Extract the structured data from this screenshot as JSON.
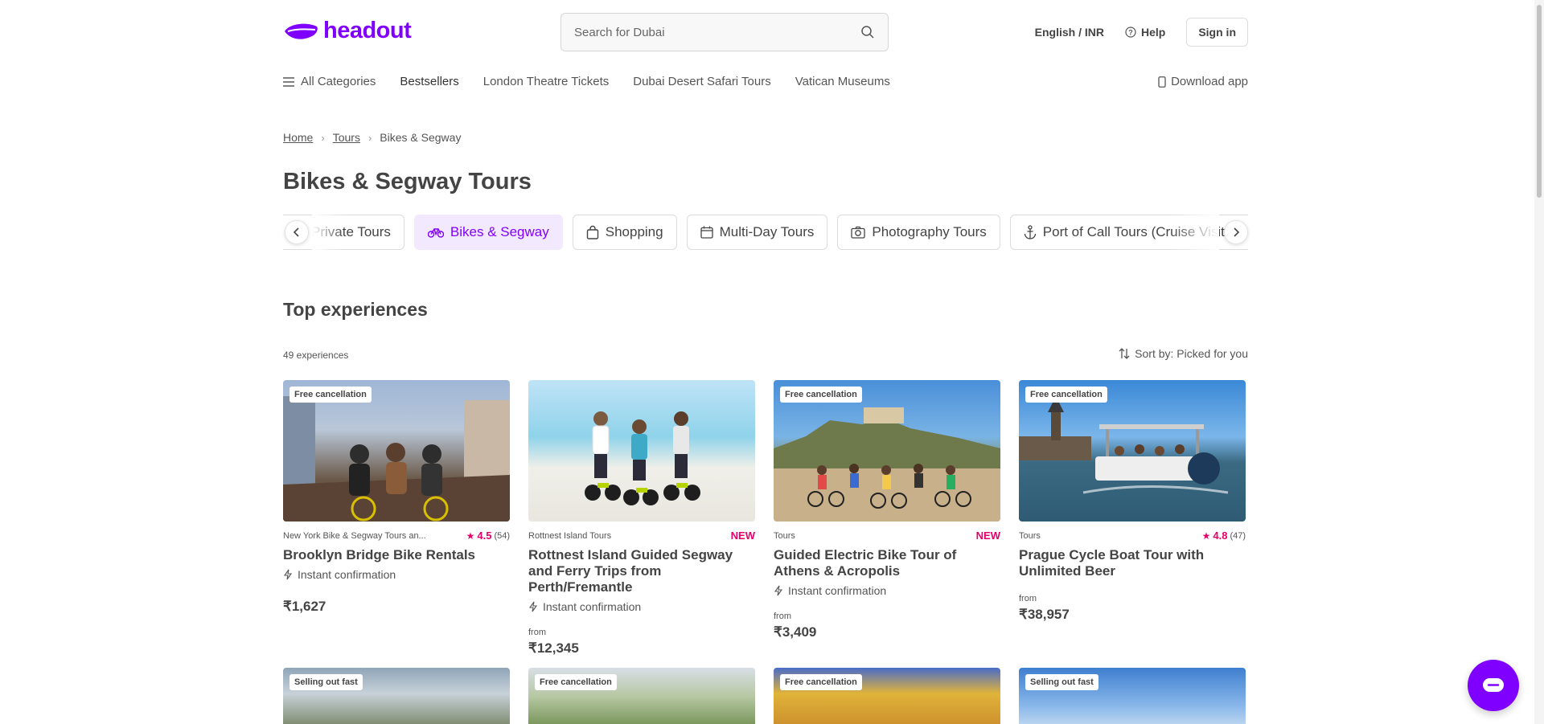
{
  "header": {
    "logo_text": "headout",
    "search_placeholder": "Search for Dubai",
    "language_currency": "English / INR",
    "help_label": "Help",
    "signin_label": "Sign in"
  },
  "nav": {
    "all_categories": "All Categories",
    "items": [
      "Bestsellers",
      "London Theatre Tickets",
      "Dubai Desert Safari Tours",
      "Vatican Museums"
    ],
    "download_app": "Download app"
  },
  "breadcrumb": {
    "home": "Home",
    "tours": "Tours",
    "current": "Bikes & Segway"
  },
  "page_title": "Bikes & Segway Tours",
  "categories": [
    {
      "label": "Private Tours",
      "icon": "none",
      "active": false
    },
    {
      "label": "Bikes & Segway",
      "icon": "bicycle-icon",
      "active": true
    },
    {
      "label": "Shopping",
      "icon": "shopping-bag-icon",
      "active": false
    },
    {
      "label": "Multi-Day Tours",
      "icon": "calendar-icon",
      "active": false
    },
    {
      "label": "Photography Tours",
      "icon": "camera-icon",
      "active": false
    },
    {
      "label": "Port of Call Tours (Cruise Visitors)",
      "icon": "anchor-icon",
      "active": false
    }
  ],
  "top_experiences": {
    "title": "Top experiences",
    "count_text": "49 experiences",
    "sort_text": "Sort by: Picked for you"
  },
  "cards": [
    {
      "badge": "Free cancellation",
      "provider": "New York Bike & Segway Tours an...",
      "rating": "4.5",
      "reviews": "(54)",
      "new_label": "",
      "title": "Brooklyn Bridge Bike Rentals",
      "confirmation": "Instant confirmation",
      "from_label": "",
      "price": "₹1,627"
    },
    {
      "badge": "",
      "provider": "Rottnest Island Tours",
      "rating": "",
      "reviews": "",
      "new_label": "NEW",
      "title": "Rottnest Island Guided Segway and Ferry Trips from Perth/Fremantle",
      "confirmation": "Instant confirmation",
      "from_label": "from",
      "price": "₹12,345"
    },
    {
      "badge": "Free cancellation",
      "provider": "Tours",
      "rating": "",
      "reviews": "",
      "new_label": "NEW",
      "title": "Guided Electric Bike Tour of Athens & Acropolis",
      "confirmation": "Instant confirmation",
      "from_label": "from",
      "price": "₹3,409"
    },
    {
      "badge": "Free cancellation",
      "provider": "Tours",
      "rating": "4.8",
      "reviews": "(47)",
      "new_label": "",
      "title": "Prague Cycle Boat Tour with Unlimited Beer",
      "confirmation": "",
      "from_label": "from",
      "price": "₹38,957"
    }
  ],
  "cards_row2_badges": [
    "Selling out fast",
    "Free cancellation",
    "Free cancellation",
    "Selling out fast"
  ],
  "colors": {
    "brand": "#8000ff",
    "rating": "#e5006a",
    "chip_active_bg": "#f3e9ff"
  }
}
